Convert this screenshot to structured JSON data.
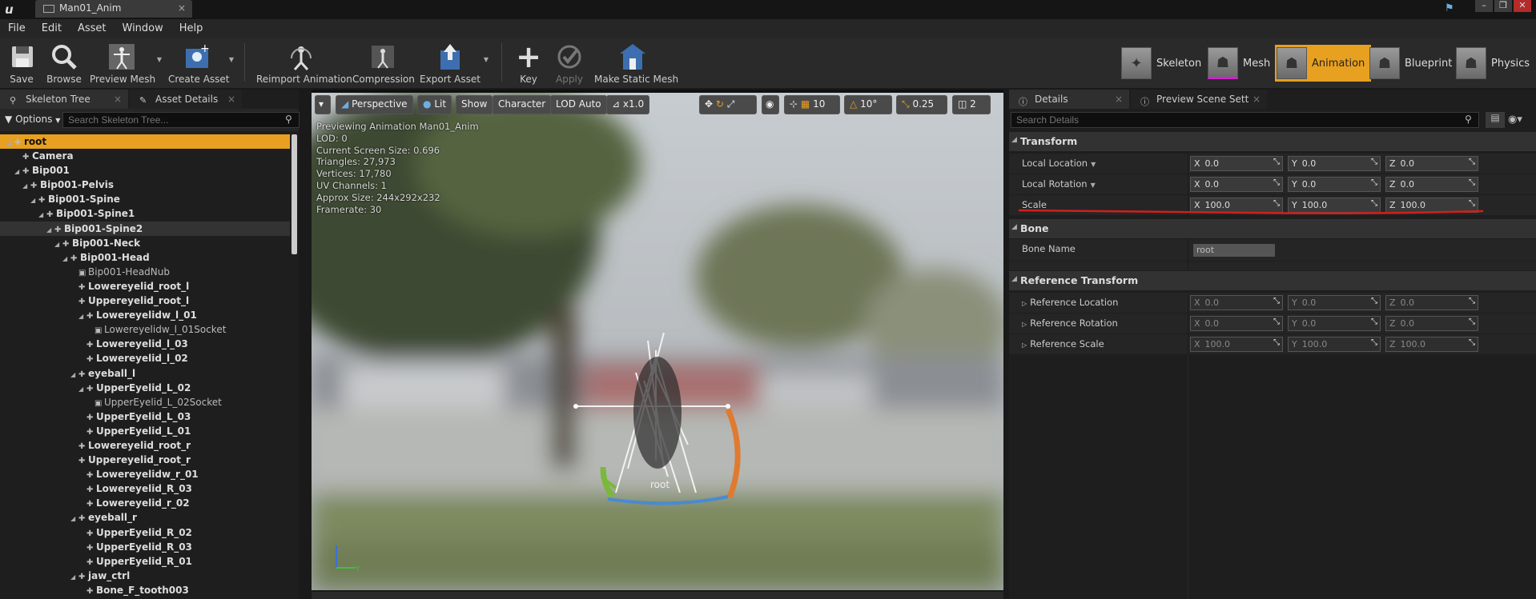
{
  "titlebar": {
    "tab_title": "Man01_Anim"
  },
  "menu": [
    "File",
    "Edit",
    "Asset",
    "Window",
    "Help"
  ],
  "toolbar": {
    "save": "Save",
    "browse": "Browse",
    "preview_mesh": "Preview Mesh",
    "create_asset": "Create Asset",
    "reimport_animation": "Reimport Animation",
    "compression": "Compression",
    "export_asset": "Export Asset",
    "key": "Key",
    "apply": "Apply",
    "make_static_mesh": "Make Static Mesh"
  },
  "modes": {
    "skeleton": "Skeleton",
    "mesh": "Mesh",
    "animation": "Animation",
    "blueprint": "Blueprint",
    "physics": "Physics",
    "active": "Animation"
  },
  "left": {
    "tab_skeleton_tree": "Skeleton Tree",
    "tab_asset_details": "Asset Details",
    "options": "Options",
    "search_placeholder": "Search Skeleton Tree...",
    "tree": [
      {
        "label": "root",
        "depth": 0,
        "state": "selected",
        "arrow": true
      },
      {
        "label": "Camera",
        "depth": 1
      },
      {
        "label": "Bip001",
        "depth": 1,
        "arrow": true
      },
      {
        "label": "Bip001-Pelvis",
        "depth": 2,
        "arrow": true
      },
      {
        "label": "Bip001-Spine",
        "depth": 3,
        "arrow": true
      },
      {
        "label": "Bip001-Spine1",
        "depth": 4,
        "arrow": true
      },
      {
        "label": "Bip001-Spine2",
        "depth": 5,
        "arrow": true,
        "state": "highlighted"
      },
      {
        "label": "Bip001-Neck",
        "depth": 6,
        "arrow": true
      },
      {
        "label": "Bip001-Head",
        "depth": 7,
        "arrow": true
      },
      {
        "label": "Bip001-HeadNub",
        "depth": 8,
        "socket": true,
        "plain": true
      },
      {
        "label": "Lowereyelid_root_l",
        "depth": 8
      },
      {
        "label": "Uppereyelid_root_l",
        "depth": 8
      },
      {
        "label": "Lowereyelidw_l_01",
        "depth": 9,
        "arrow": true
      },
      {
        "label": "Lowereyelidw_l_01Socket",
        "depth": 10,
        "socket": true
      },
      {
        "label": "Lowereyelid_l_03",
        "depth": 9
      },
      {
        "label": "Lowereyelid_l_02",
        "depth": 9
      },
      {
        "label": "eyeball_l",
        "depth": 8,
        "arrow": true
      },
      {
        "label": "UpperEyelid_L_02",
        "depth": 9,
        "arrow": true
      },
      {
        "label": "UpperEyelid_L_02Socket",
        "depth": 10,
        "socket": true
      },
      {
        "label": "UpperEyelid_L_03",
        "depth": 9
      },
      {
        "label": "UpperEyelid_L_01",
        "depth": 9
      },
      {
        "label": "Lowereyelid_root_r",
        "depth": 8
      },
      {
        "label": "Uppereyelid_root_r",
        "depth": 8
      },
      {
        "label": "Lowereyelidw_r_01",
        "depth": 9
      },
      {
        "label": "Lowereyelid_R_03",
        "depth": 9
      },
      {
        "label": "Lowereyelid_r_02",
        "depth": 9
      },
      {
        "label": "eyeball_r",
        "depth": 8,
        "arrow": true
      },
      {
        "label": "UpperEyelid_R_02",
        "depth": 9
      },
      {
        "label": "UpperEyelid_R_03",
        "depth": 9
      },
      {
        "label": "UpperEyelid_R_01",
        "depth": 9
      },
      {
        "label": "jaw_ctrl",
        "depth": 8,
        "arrow": true
      },
      {
        "label": "Bone_F_tooth003",
        "depth": 9
      }
    ]
  },
  "viewport": {
    "toolbar": {
      "perspective": "Perspective",
      "lit": "Lit",
      "show": "Show",
      "character": "Character",
      "lod": "LOD Auto",
      "speed": "x1.0",
      "grid_snap": "10",
      "rot_snap": "10°",
      "scale_snap": "0.25",
      "cam_speed": "2"
    },
    "info": [
      "Previewing Animation Man01_Anim",
      "LOD: 0",
      "Current Screen Size: 0.696",
      "Triangles: 27,973",
      "Vertices: 17,780",
      "UV Channels: 1",
      "Approx Size: 244x292x232",
      "Framerate: 30"
    ],
    "root_label": "root"
  },
  "details": {
    "tab_details": "Details",
    "tab_preview": "Preview Scene Sett",
    "search_placeholder": "Search Details",
    "transform_title": "Transform",
    "local_location": {
      "label": "Local Location",
      "x": "0.0",
      "y": "0.0",
      "z": "0.0"
    },
    "local_rotation": {
      "label": "Local Rotation",
      "x": "0.0",
      "y": "0.0",
      "z": "0.0"
    },
    "scale": {
      "label": "Scale",
      "x": "100.0",
      "y": "100.0",
      "z": "100.0"
    },
    "bone_title": "Bone",
    "bone_name_label": "Bone Name",
    "bone_name_value": "root",
    "ref_title": "Reference Transform",
    "ref_location": {
      "label": "Reference Location",
      "x": "0.0",
      "y": "0.0",
      "z": "0.0"
    },
    "ref_rotation": {
      "label": "Reference Rotation",
      "x": "0.0",
      "y": "0.0",
      "z": "0.0"
    },
    "ref_scale": {
      "label": "Reference Scale",
      "x": "100.0",
      "y": "100.0",
      "z": "100.0"
    }
  },
  "colors": {
    "accent": "#e8a020",
    "annotation": "#d0201e"
  }
}
